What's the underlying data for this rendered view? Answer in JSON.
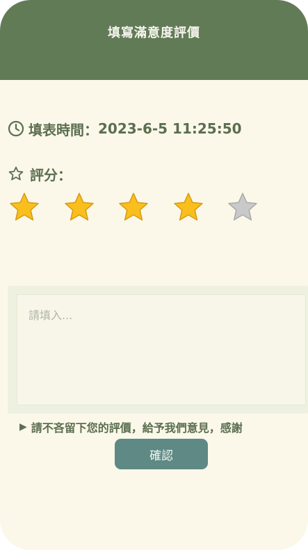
{
  "header": {
    "title": "填寫滿意度評價",
    "background": "#627b57"
  },
  "form_time": {
    "icon": "clock-icon",
    "label": "填表時間：",
    "value": "2023-6-5 11:25:50"
  },
  "rating": {
    "icon": "star-outline-icon",
    "label": "評分：",
    "value": 4,
    "max": 5,
    "filled_color": "#fbbf1d",
    "empty_color": "#c9c9c9"
  },
  "comment": {
    "placeholder": "請填入...",
    "value": ""
  },
  "hint": {
    "icon": "play-triangle-icon",
    "text": "請不吝留下您的評價，給予我們意見，感謝"
  },
  "confirm_button": {
    "label": "確認",
    "color": "#5e8985"
  }
}
